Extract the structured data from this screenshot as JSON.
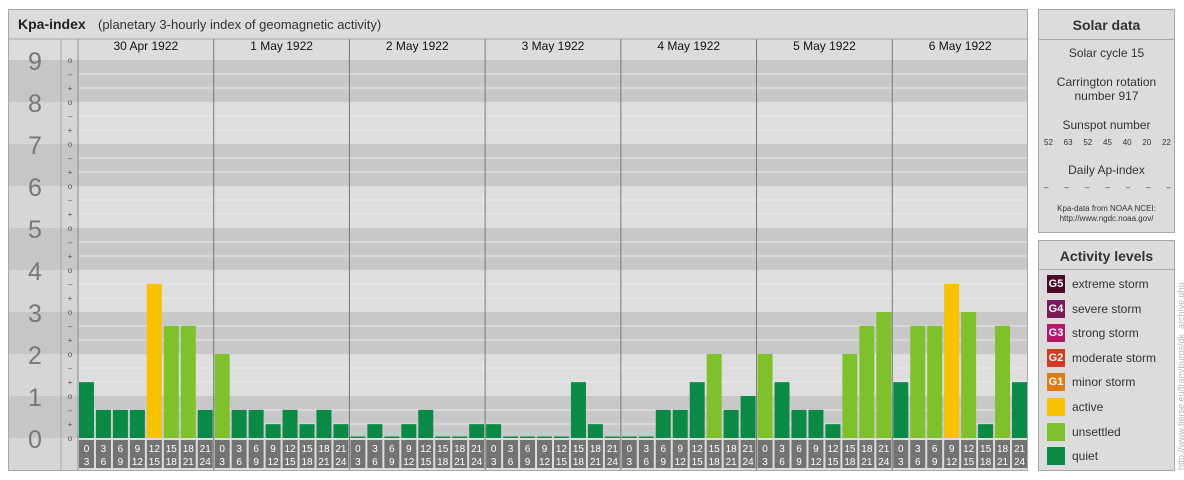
{
  "header": {
    "title": "Kpa-index",
    "subtitle": "(planetary 3-hourly index of geomagnetic activity)"
  },
  "colors": {
    "quiet": "#0a8a45",
    "unsettled": "#7ec12a",
    "active": "#f8c200",
    "minor": "#e07c15",
    "moderate": "#d33a22",
    "strong": "#b5176b",
    "severe": "#7a1a5a",
    "extreme": "#4a0a28"
  },
  "chart_data": {
    "type": "bar",
    "title": "Kpa-index",
    "ylim": [
      0,
      9
    ],
    "y_ticks": [
      "0",
      "1",
      "2",
      "3",
      "4",
      "5",
      "6",
      "7",
      "8",
      "9"
    ],
    "sub_ticks": [
      "o",
      "+",
      "–"
    ],
    "days": [
      "30 Apr 1922",
      "1 May 1922",
      "2 May 1922",
      "3 May 1922",
      "4 May 1922",
      "5 May 1922",
      "6 May 1922"
    ],
    "interval_labels": [
      [
        "0",
        "3"
      ],
      [
        "3",
        "6"
      ],
      [
        "6",
        "9"
      ],
      [
        "9",
        "12"
      ],
      [
        "12",
        "15"
      ],
      [
        "15",
        "18"
      ],
      [
        "18",
        "21"
      ],
      [
        "21",
        "24"
      ]
    ],
    "values": [
      [
        1.33,
        0.67,
        0.67,
        0.67,
        3.67,
        2.67,
        2.67,
        0.67
      ],
      [
        2.0,
        0.67,
        0.67,
        0.33,
        0.67,
        0.33,
        0.67,
        0.33
      ],
      [
        0.0,
        0.33,
        0.0,
        0.33,
        0.67,
        0.0,
        0.0,
        0.33
      ],
      [
        0.33,
        0.0,
        0.0,
        0.0,
        0.0,
        1.33,
        0.33,
        0.0
      ],
      [
        0.0,
        0.0,
        0.67,
        0.67,
        1.33,
        2.0,
        0.67,
        1.0
      ],
      [
        2.0,
        1.33,
        0.67,
        0.67,
        0.33,
        2.0,
        2.67,
        3.0
      ],
      [
        1.33,
        2.67,
        2.67,
        3.67,
        3.0,
        0.33,
        2.67,
        1.33
      ]
    ]
  },
  "solar": {
    "title": "Solar data",
    "cycle": "Solar cycle 15",
    "carrington_line1": "Carrington rotation",
    "carrington_line2": "number 917",
    "sunspot_label": "Sunspot number",
    "sunspot_values": [
      "52",
      "63",
      "52",
      "45",
      "40",
      "20",
      "22"
    ],
    "ap_label": "Daily Ap-index",
    "ap_values": [
      "–",
      "–",
      "–",
      "–",
      "–",
      "–",
      "–"
    ],
    "credit_line1": "Kpa-data from NOAA NCEI:",
    "credit_line2": "http://www.ngdc.noaa.gov/"
  },
  "levels": {
    "title": "Activity levels",
    "items": [
      {
        "badge": "G5",
        "label": "extreme storm",
        "color": "#4a0a28"
      },
      {
        "badge": "G4",
        "label": "severe storm",
        "color": "#7a1a5a"
      },
      {
        "badge": "G3",
        "label": "strong storm",
        "color": "#b5176b"
      },
      {
        "badge": "G2",
        "label": "moderate storm",
        "color": "#d33a22"
      },
      {
        "badge": "G1",
        "label": "minor storm",
        "color": "#e07c15"
      },
      {
        "badge": "",
        "label": "active",
        "color": "#f8c200"
      },
      {
        "badge": "",
        "label": "unsettled",
        "color": "#7ec12a"
      },
      {
        "badge": "",
        "label": "quiet",
        "color": "#0a8a45"
      }
    ]
  },
  "watermark": "http://www.tierse.eu/fram/burgs/dk_archive.php"
}
